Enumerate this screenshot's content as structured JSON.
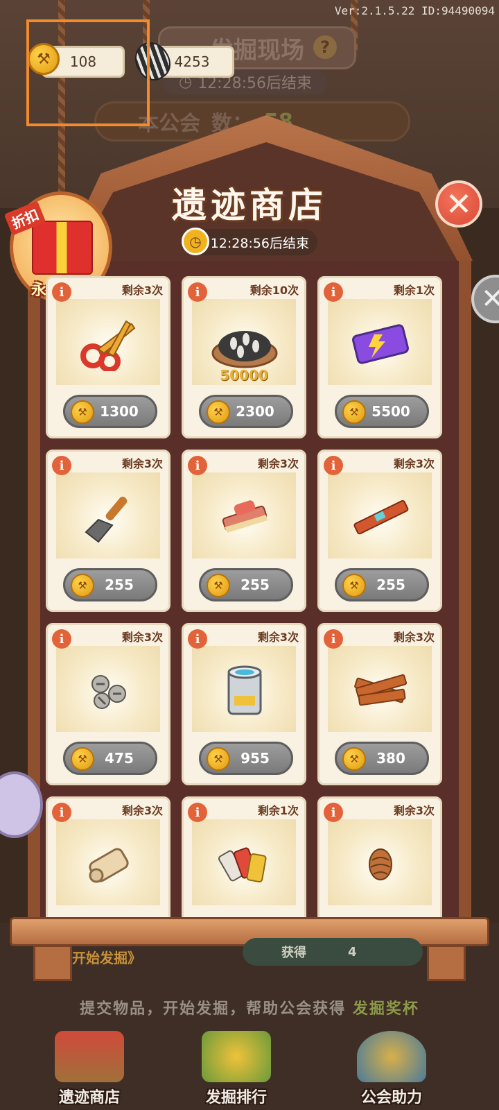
{
  "version": "Ver:2.1.5.22 ID:94490094",
  "currency": {
    "hammers": "108",
    "seeds": "4253"
  },
  "site": {
    "title": "发掘现场",
    "timer": "12:28:56后结束",
    "guild_label": "本公会",
    "guild_count_label": "数：",
    "guild_count": "58"
  },
  "shop": {
    "title": "遗迹商店",
    "timer": "12:28:56后结束",
    "close_symbol": "✕"
  },
  "gift": {
    "tag": "折扣",
    "label": "永森好礼"
  },
  "items": [
    {
      "name": "scissors",
      "remaining": "剩余3次",
      "price": "1300",
      "bonus": ""
    },
    {
      "name": "seeds-pile",
      "remaining": "剩余10次",
      "price": "2300",
      "bonus": "50000"
    },
    {
      "name": "energy-ticket",
      "remaining": "剩余1次",
      "price": "5500",
      "bonus": ""
    },
    {
      "name": "trowel",
      "remaining": "剩余3次",
      "price": "255",
      "bonus": ""
    },
    {
      "name": "brush",
      "remaining": "剩余3次",
      "price": "255",
      "bonus": ""
    },
    {
      "name": "level-tool",
      "remaining": "剩余3次",
      "price": "255",
      "bonus": ""
    },
    {
      "name": "screws",
      "remaining": "剩余3次",
      "price": "475",
      "bonus": ""
    },
    {
      "name": "paint-can",
      "remaining": "剩余3次",
      "price": "955",
      "bonus": ""
    },
    {
      "name": "wood-planks",
      "remaining": "剩余3次",
      "price": "380",
      "bonus": ""
    },
    {
      "name": "scroll",
      "remaining": "剩余3次",
      "price": "",
      "bonus": ""
    },
    {
      "name": "paint-tubes",
      "remaining": "剩余1次",
      "price": "",
      "bonus": ""
    },
    {
      "name": "pinecone",
      "remaining": "剩余3次",
      "price": "",
      "bonus": ""
    }
  ],
  "bottom": {
    "dig_start": "开始发掘》",
    "reward_label": "获得",
    "reward_count": "4",
    "footer_prefix": "提交物品，开始发掘，帮助公会获得",
    "footer_highlight": "发掘奖杯",
    "tabs": [
      "遗迹商店",
      "发掘排行",
      "公会助力"
    ]
  }
}
